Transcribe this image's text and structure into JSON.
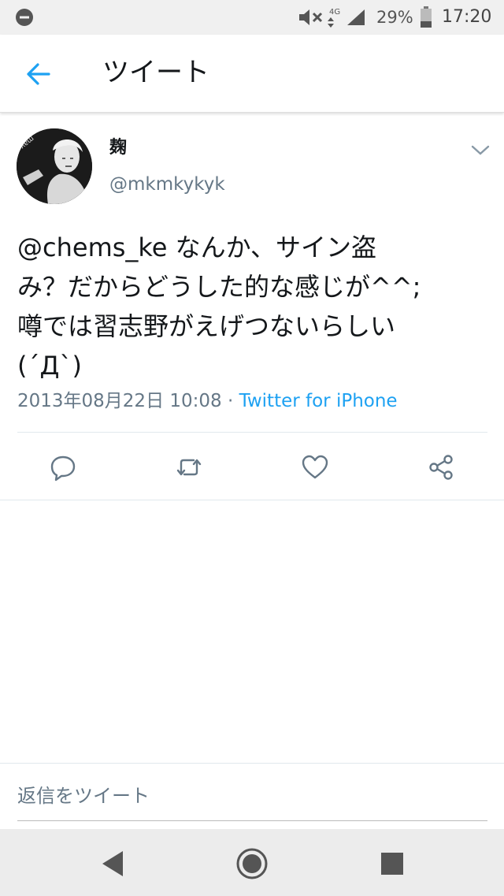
{
  "status_bar": {
    "network": "4G",
    "battery_percent": "29%",
    "time": "17:20",
    "icons": [
      "do-not-disturb-icon",
      "mute-icon",
      "4g-data-icon",
      "signal-icon",
      "battery-icon"
    ]
  },
  "header": {
    "title": "ツイート",
    "back_icon": "arrow-left-icon",
    "accent_color": "#1da1f2"
  },
  "tweet": {
    "display_name": "麹",
    "handle": "@mkmkykyk",
    "text_lines": [
      "@chems_ke なんか、サイン盗",
      "み？だからどうした的な感じが^^;",
      "噂では習志野がえげつないらしい",
      "(´Д`)"
    ],
    "timestamp": "2013年08月22日 10:08",
    "separator": " · ",
    "source": "Twitter for iPhone",
    "actions": [
      "reply-icon",
      "retweet-icon",
      "like-icon",
      "share-icon"
    ]
  },
  "reply": {
    "placeholder": "返信をツイート"
  },
  "nav": {
    "buttons": [
      "back-triangle-icon",
      "home-circle-icon",
      "recents-square-icon"
    ]
  }
}
